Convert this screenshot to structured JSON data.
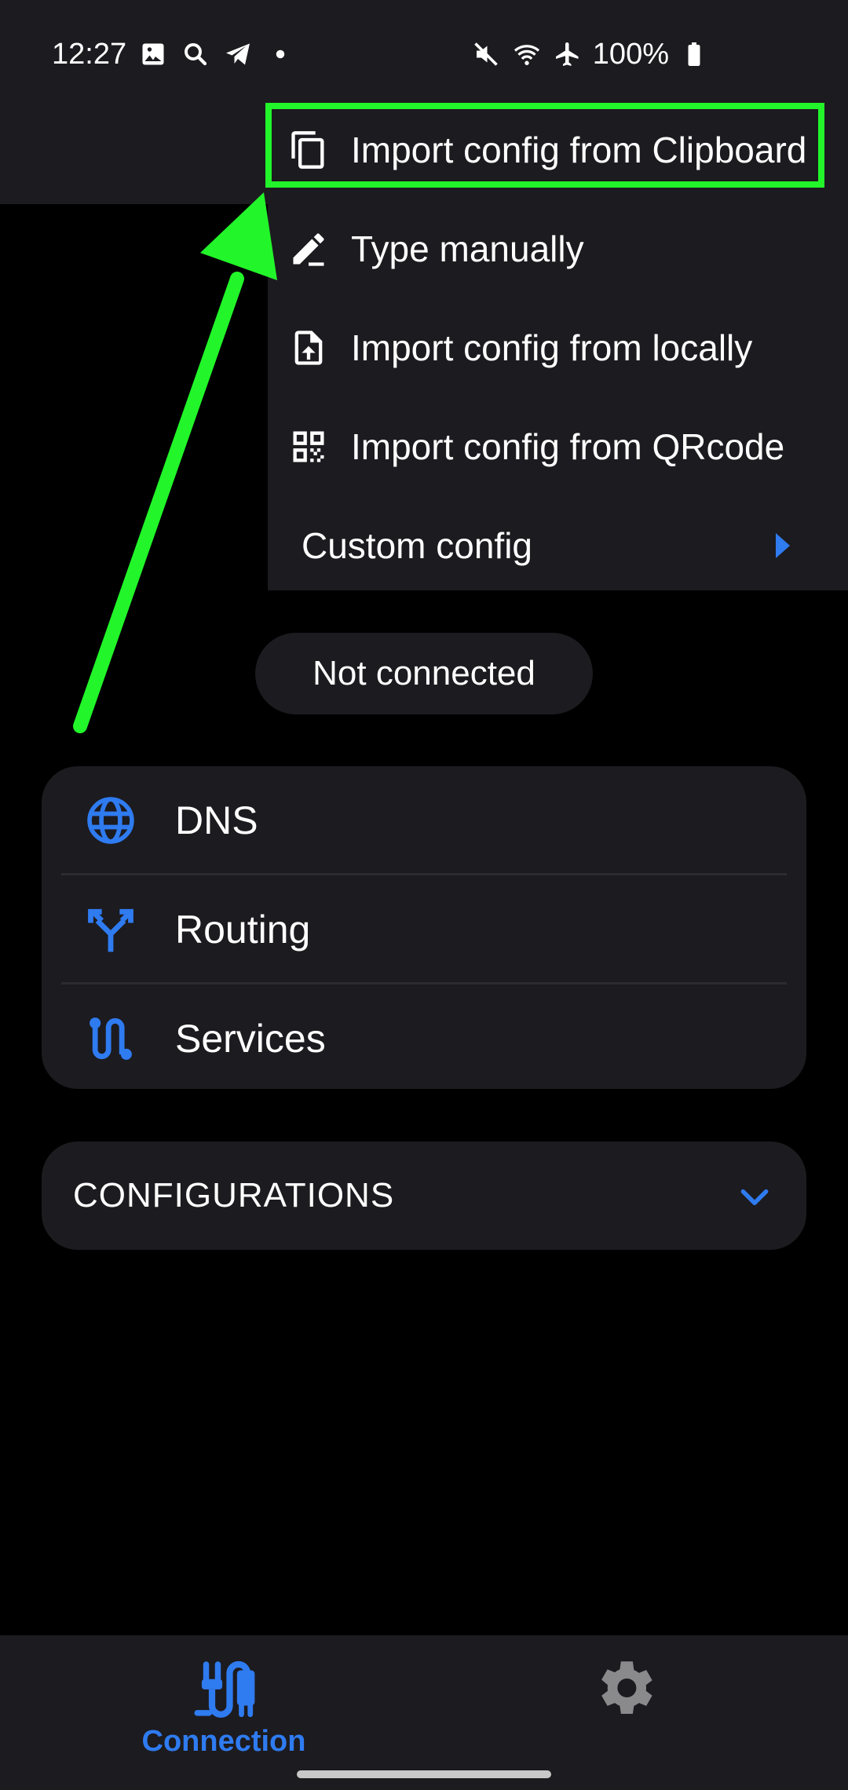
{
  "status_bar": {
    "time": "12:27",
    "battery": "100%",
    "left_icons": [
      "image-icon",
      "search-icon",
      "telegram-icon",
      "dot-icon"
    ],
    "right_icons": [
      "mute-icon",
      "wifi-icon",
      "airplane-icon",
      "battery-icon"
    ]
  },
  "menu": {
    "items": [
      {
        "label": "Import config from Clipboard",
        "icon": "copy-icon"
      },
      {
        "label": "Type manually",
        "icon": "edit-icon"
      },
      {
        "label": "Import config from locally",
        "icon": "file-upload-icon"
      },
      {
        "label": "Import config from QRcode",
        "icon": "qrcode-icon"
      },
      {
        "label": "Custom config",
        "icon": "chevron-right-icon"
      }
    ]
  },
  "connection_status": "Not connected",
  "options": [
    {
      "label": "DNS",
      "icon": "globe-icon"
    },
    {
      "label": "Routing",
      "icon": "routing-icon"
    },
    {
      "label": "Services",
      "icon": "services-icon"
    }
  ],
  "configurations": {
    "label": "CONFIGURATIONS",
    "icon": "chevron-down-icon"
  },
  "bottom_nav": {
    "items": [
      {
        "label": "Connection",
        "icon": "connection-icon",
        "active": true
      },
      {
        "label": "",
        "icon": "gear-icon",
        "active": false
      }
    ]
  },
  "colors": {
    "accent": "#2f7bf0",
    "highlight": "#22f52a",
    "surface": "#1c1b1f",
    "background": "#000000"
  }
}
